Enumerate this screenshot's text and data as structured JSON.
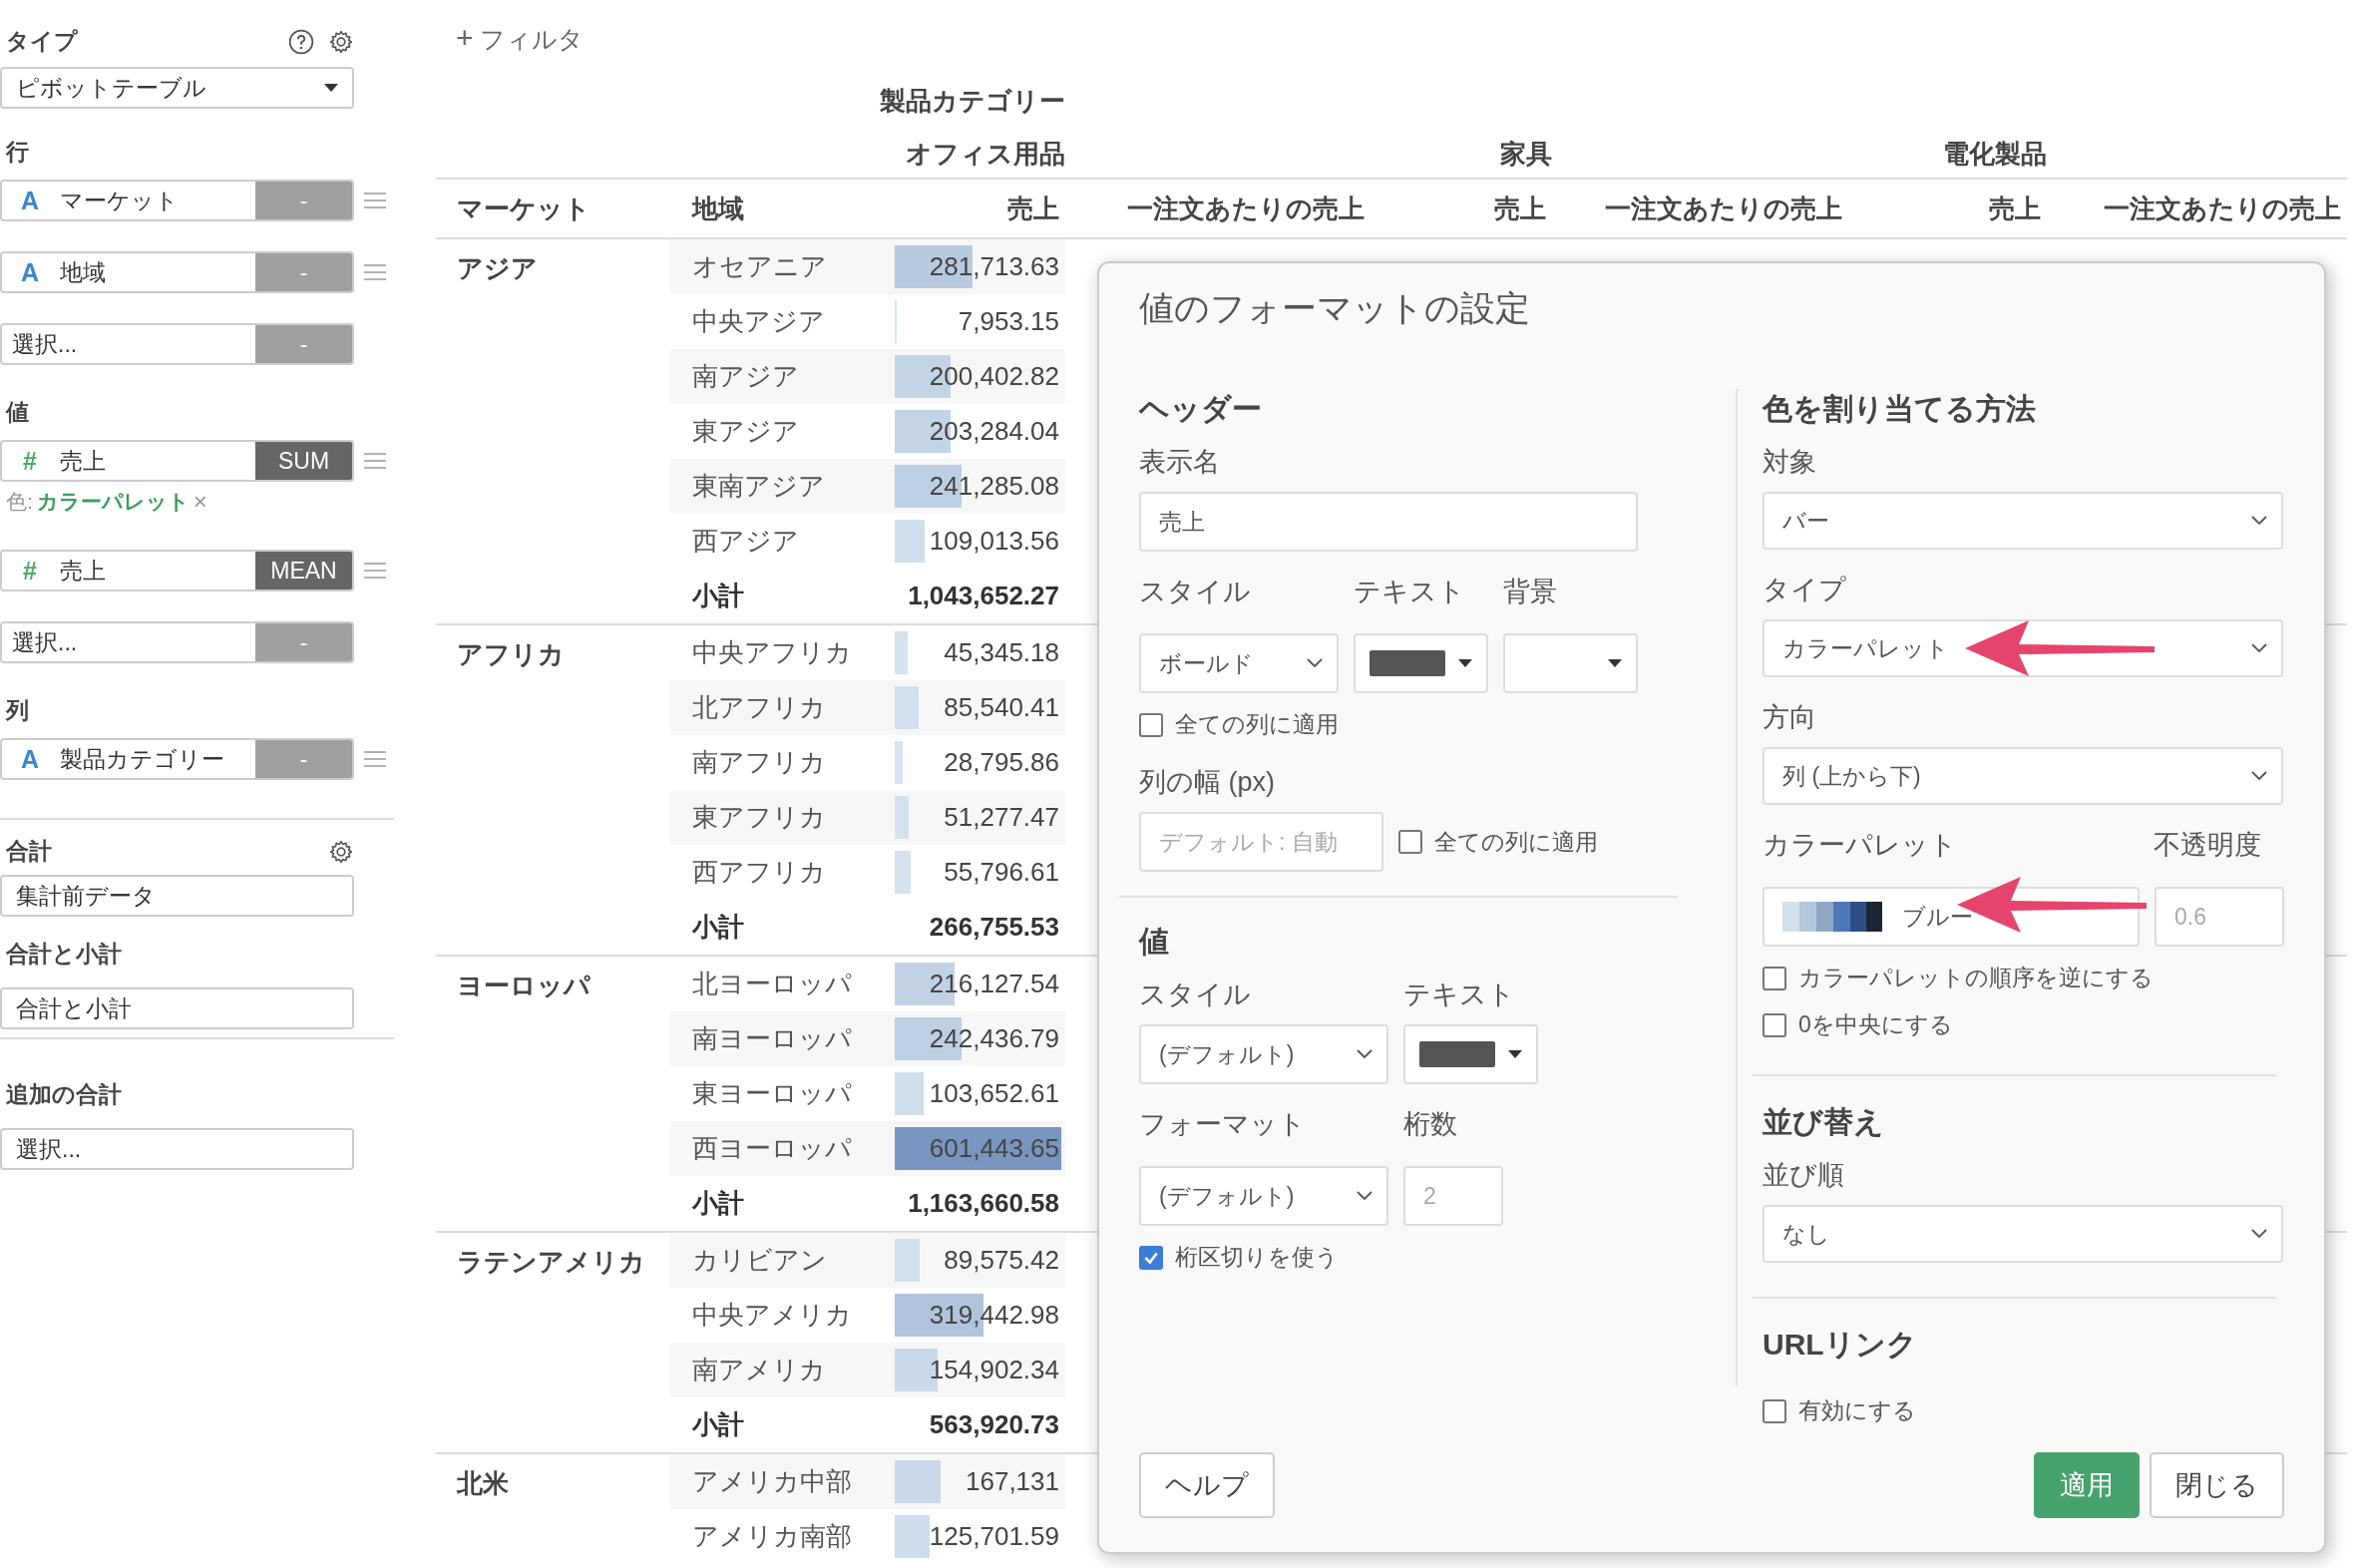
{
  "sidebar": {
    "type_section": {
      "label": "タイプ",
      "value": "ピボットテーブル"
    },
    "rows_section": {
      "label": "行",
      "fields": [
        {
          "kind": "text",
          "icon": "A",
          "name": "マーケット",
          "agg": "-",
          "agg_active": false
        },
        {
          "kind": "text",
          "icon": "A",
          "name": "地域",
          "agg": "-",
          "agg_active": false
        },
        {
          "kind": "empty",
          "name": "選択...",
          "agg": "-",
          "agg_active": false
        }
      ]
    },
    "values_section": {
      "label": "値",
      "fields": [
        {
          "kind": "number",
          "icon": "#",
          "name": "売上",
          "agg": "SUM",
          "agg_active": true,
          "color_label": "色:",
          "color_value": "カラーパレット",
          "remove": "×"
        },
        {
          "kind": "number",
          "icon": "#",
          "name": "売上",
          "agg": "MEAN",
          "agg_active": true
        },
        {
          "kind": "empty",
          "name": "選択...",
          "agg": "-",
          "agg_active": false
        }
      ]
    },
    "columns_section": {
      "label": "列",
      "fields": [
        {
          "kind": "text",
          "icon": "A",
          "name": "製品カテゴリー",
          "agg": "-",
          "agg_active": false
        }
      ]
    },
    "total_section": {
      "label": "合計",
      "value": "集計前データ"
    },
    "subtotal_section": {
      "label": "合計と小計",
      "value": "合計と小計"
    },
    "extra_total_section": {
      "label": "追加の合計",
      "value": "選択..."
    }
  },
  "filter_button": {
    "icon": "+",
    "label": "フィルタ"
  },
  "table": {
    "pivot_label": "製品カテゴリー",
    "categories": [
      "オフィス用品",
      "家具",
      "電化製品"
    ],
    "columns": [
      "マーケット",
      "地域",
      "売上",
      "一注文あたりの売上",
      "売上",
      "一注文あたりの売上",
      "売上",
      "一注文あたりの売上"
    ],
    "groups": [
      {
        "market": "アジア",
        "regions": [
          {
            "name": "オセアニア",
            "value": "281,713.63",
            "level": 0.468
          },
          {
            "name": "中央アジア",
            "value": "7,953.15",
            "level": 0.013
          },
          {
            "name": "南アジア",
            "value": "200,402.82",
            "level": 0.333
          },
          {
            "name": "東アジア",
            "value": "203,284.04",
            "level": 0.338
          },
          {
            "name": "東南アジア",
            "value": "241,285.08",
            "level": 0.401
          },
          {
            "name": "西アジア",
            "value": "109,013.56",
            "level": 0.181
          }
        ],
        "subtotal": {
          "label": "小計",
          "value": "1,043,652.27"
        }
      },
      {
        "market": "アフリカ",
        "regions": [
          {
            "name": "中央アフリカ",
            "value": "45,345.18",
            "level": 0.075
          },
          {
            "name": "北アフリカ",
            "value": "85,540.41",
            "level": 0.142
          },
          {
            "name": "南アフリカ",
            "value": "28,795.86",
            "level": 0.048
          },
          {
            "name": "東アフリカ",
            "value": "51,277.47",
            "level": 0.085
          },
          {
            "name": "西アフリカ",
            "value": "55,796.61",
            "level": 0.093
          }
        ],
        "subtotal": {
          "label": "小計",
          "value": "266,755.53"
        }
      },
      {
        "market": "ヨーロッパ",
        "regions": [
          {
            "name": "北ヨーロッパ",
            "value": "216,127.54",
            "level": 0.359
          },
          {
            "name": "南ヨーロッパ",
            "value": "242,436.79",
            "level": 0.403
          },
          {
            "name": "東ヨーロッパ",
            "value": "103,652.61",
            "level": 0.172
          },
          {
            "name": "西ヨーロッパ",
            "value": "601,443.65",
            "level": 1.0
          }
        ],
        "subtotal": {
          "label": "小計",
          "value": "1,163,660.58"
        }
      },
      {
        "market": "ラテンアメリカ",
        "regions": [
          {
            "name": "カリビアン",
            "value": "89,575.42",
            "level": 0.149
          },
          {
            "name": "中央アメリカ",
            "value": "319,442.98",
            "level": 0.531
          },
          {
            "name": "南アメリカ",
            "value": "154,902.34",
            "level": 0.258
          }
        ],
        "subtotal": {
          "label": "小計",
          "value": "563,920.73"
        }
      },
      {
        "market": "北米",
        "regions": [
          {
            "name": "アメリカ中部",
            "value": "167,131",
            "level": 0.278
          },
          {
            "name": "アメリカ南部",
            "value": "125,701.59",
            "level": 0.209
          }
        ]
      }
    ]
  },
  "dialog": {
    "title": "値のフォーマットの設定",
    "header_section": {
      "heading": "ヘッダー",
      "display_name_label": "表示名",
      "display_name_value": "売上",
      "style_label": "スタイル",
      "style_value": "ボールド",
      "text_label": "テキスト",
      "bg_label": "背景",
      "apply_all": {
        "label": "全ての列に適用",
        "checked": false
      },
      "width_label": "列の幅 (px)",
      "width_placeholder": "デフォルト: 自動",
      "width_apply_all": {
        "label": "全ての列に適用",
        "checked": false
      }
    },
    "value_section": {
      "heading": "値",
      "style_label": "スタイル",
      "style_value": "(デフォルト)",
      "text_label": "テキスト",
      "format_label": "フォーマット",
      "format_value": "(デフォルト)",
      "digits_label": "桁数",
      "digits_placeholder": "2",
      "separator": {
        "label": "桁区切りを使う",
        "checked": true
      }
    },
    "color_section": {
      "heading": "色を割り当てる方法",
      "target_label": "対象",
      "target_value": "バー",
      "type_label": "タイプ",
      "type_value": "カラーパレット",
      "direction_label": "方向",
      "direction_value": "列 (上から下)",
      "palette_label": "カラーパレット",
      "palette_value": "ブルー",
      "opacity_label": "不透明度",
      "opacity_placeholder": "0.6",
      "reverse": {
        "label": "カラーパレットの順序を逆にする",
        "checked": false
      },
      "center_zero": {
        "label": "0を中央にする",
        "checked": false
      }
    },
    "sort_section": {
      "heading": "並び替え",
      "order_label": "並び順",
      "order_value": "なし"
    },
    "url_section": {
      "heading": "URLリンク",
      "enable": {
        "label": "有効にする",
        "checked": false
      }
    },
    "buttons": [
      {
        "kind": "secondary",
        "label": "ヘルプ"
      },
      {
        "kind": "primary",
        "label": "適用"
      },
      {
        "kind": "secondary",
        "label": "閉じる"
      }
    ]
  }
}
